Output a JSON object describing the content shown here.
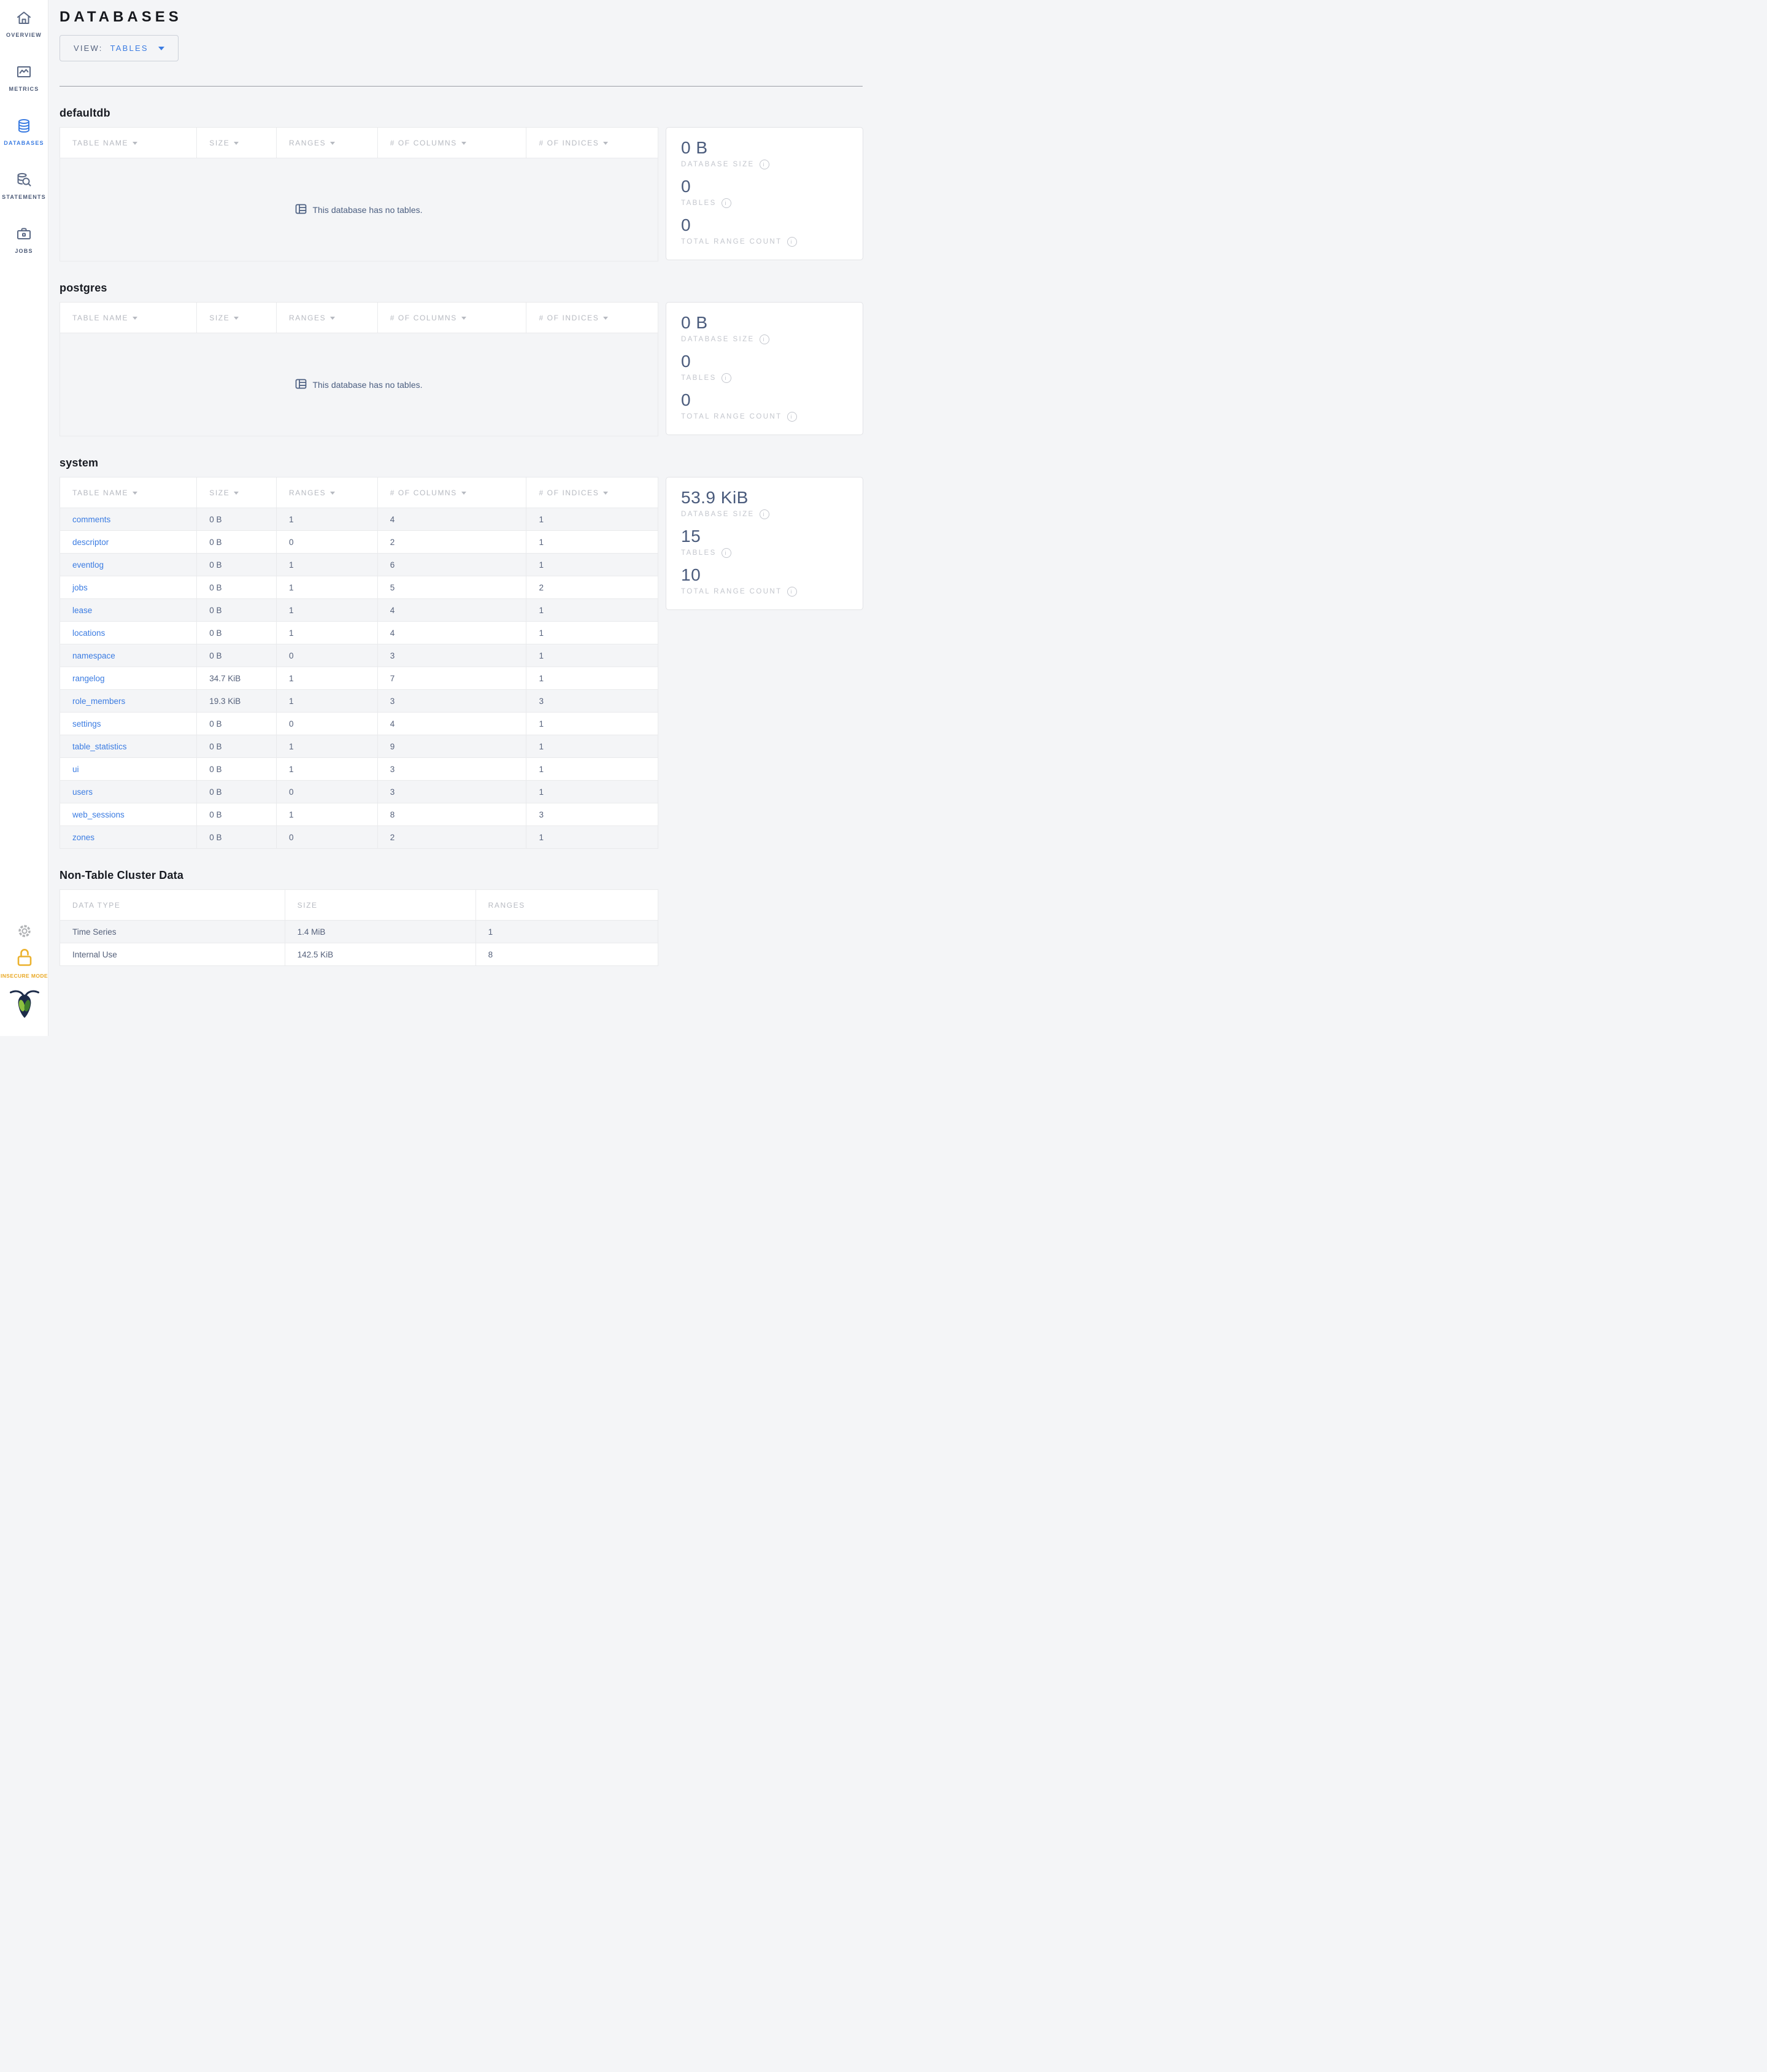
{
  "sidebar": {
    "nav": [
      {
        "label": "OVERVIEW",
        "icon": "house-icon",
        "active": false
      },
      {
        "label": "METRICS",
        "icon": "metrics-chart-icon",
        "active": false
      },
      {
        "label": "DATABASES",
        "icon": "database-icon",
        "active": true
      },
      {
        "label": "STATEMENTS",
        "icon": "database-search-icon",
        "active": false
      },
      {
        "label": "JOBS",
        "icon": "briefcase-icon",
        "active": false
      }
    ],
    "insecure_label": "INSECURE MODE"
  },
  "header": {
    "title": "DATABASES",
    "view_label": "VIEW:",
    "view_value": "TABLES"
  },
  "table_columns": [
    "TABLE NAME",
    "SIZE",
    "RANGES",
    "# OF COLUMNS",
    "# OF INDICES"
  ],
  "empty_message": "This database has no tables.",
  "stat_labels": {
    "size": "DATABASE SIZE",
    "tables": "TABLES",
    "ranges": "TOTAL RANGE COUNT"
  },
  "databases": [
    {
      "name": "defaultdb",
      "rows": [],
      "stats": {
        "size": "0 B",
        "tables": "0",
        "ranges": "0"
      }
    },
    {
      "name": "postgres",
      "rows": [],
      "stats": {
        "size": "0 B",
        "tables": "0",
        "ranges": "0"
      }
    },
    {
      "name": "system",
      "rows": [
        [
          "comments",
          "0 B",
          "1",
          "4",
          "1"
        ],
        [
          "descriptor",
          "0 B",
          "0",
          "2",
          "1"
        ],
        [
          "eventlog",
          "0 B",
          "1",
          "6",
          "1"
        ],
        [
          "jobs",
          "0 B",
          "1",
          "5",
          "2"
        ],
        [
          "lease",
          "0 B",
          "1",
          "4",
          "1"
        ],
        [
          "locations",
          "0 B",
          "1",
          "4",
          "1"
        ],
        [
          "namespace",
          "0 B",
          "0",
          "3",
          "1"
        ],
        [
          "rangelog",
          "34.7 KiB",
          "1",
          "7",
          "1"
        ],
        [
          "role_members",
          "19.3 KiB",
          "1",
          "3",
          "3"
        ],
        [
          "settings",
          "0 B",
          "0",
          "4",
          "1"
        ],
        [
          "table_statistics",
          "0 B",
          "1",
          "9",
          "1"
        ],
        [
          "ui",
          "0 B",
          "1",
          "3",
          "1"
        ],
        [
          "users",
          "0 B",
          "0",
          "3",
          "1"
        ],
        [
          "web_sessions",
          "0 B",
          "1",
          "8",
          "3"
        ],
        [
          "zones",
          "0 B",
          "0",
          "2",
          "1"
        ]
      ],
      "stats": {
        "size": "53.9 KiB",
        "tables": "15",
        "ranges": "10"
      }
    }
  ],
  "non_table": {
    "title": "Non-Table Cluster Data",
    "columns": [
      "DATA TYPE",
      "SIZE",
      "RANGES"
    ],
    "rows": [
      [
        "Time Series",
        "1.4 MiB",
        "1"
      ],
      [
        "Internal Use",
        "142.5 KiB",
        "8"
      ]
    ]
  },
  "colors": {
    "accent_blue": "#3b7ce2",
    "stat_slate": "#4a5b7c",
    "insecure_amber": "#e9a823",
    "logo_navy": "#1c2b49",
    "logo_green_light": "#8cc23f",
    "logo_green_dark": "#3f7d2c"
  }
}
